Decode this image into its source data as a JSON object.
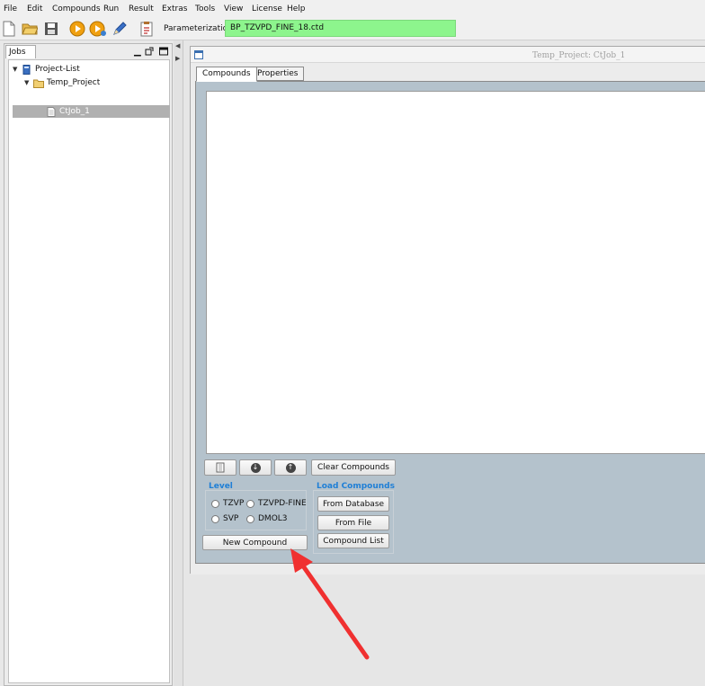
{
  "menu": [
    "File",
    "Edit",
    "Compounds",
    "Run",
    "Result",
    "Extras",
    "Tools",
    "View",
    "License",
    "Help"
  ],
  "toolbar": {
    "icons": [
      "new-file-icon",
      "open-folder-icon",
      "save-icon",
      "run-icon",
      "run-queue-icon",
      "edit-pencil-icon",
      "clipboard-icon"
    ],
    "param_label": "Parameterization:",
    "param_value": "BP_TZVPD_FINE_18.ctd"
  },
  "jobs_panel": {
    "tab_label": "Jobs",
    "tree": {
      "root": "Project-List",
      "project": "Temp_Project",
      "job": "CtJob_1"
    }
  },
  "job_window": {
    "title": "Temp_Project: CtJob_1",
    "tabs": [
      "Compounds",
      "Properties"
    ]
  },
  "compounds": {
    "clear_button": "Clear Compounds",
    "level_title": "Level",
    "levels": [
      "TZVP",
      "TZVPD-FINE",
      "SVP",
      "DMOL3"
    ],
    "load_title": "Load Compounds",
    "from_database": "From Database",
    "from_file": "From File",
    "compound_list": "Compound List",
    "new_compound": "New Compound"
  },
  "colors": {
    "param_field": "#8df58d",
    "group_title": "#1f7fd6",
    "tab_content_bg": "#b4c2cc",
    "annotation_arrow": "#f03030"
  }
}
